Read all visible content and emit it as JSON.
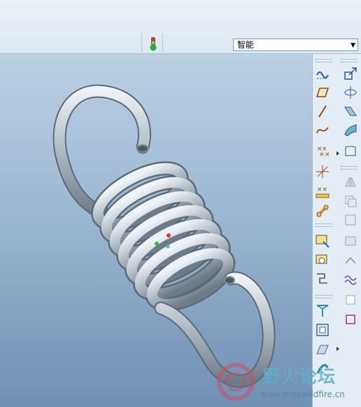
{
  "toolbar": {
    "filter_value": "智能",
    "filter_arrow": "▼"
  },
  "icons": {
    "toolbar": [
      "traffic-light-icon"
    ],
    "datum_column": [
      "datum-display-icon",
      "datum-plane-icon",
      "datum-axis-icon",
      "datum-curve-icon",
      "datum-point-icon",
      "coordinate-system-icon",
      "analysis-icon",
      "reference-icon"
    ],
    "feature_column": [
      "copy-icon",
      "revolve-icon",
      "sweep-icon",
      "blend-icon",
      "boundary-icon",
      "mirror-icon",
      "merge-icon",
      "trim-icon",
      "offset-icon",
      "thicken-icon",
      "solidify-icon",
      "extend-icon",
      "project-icon",
      "wrap-icon"
    ],
    "sketch_column": [
      "sketch-icon",
      "style-icon",
      "flatten-icon",
      "hole-icon",
      "shell-icon",
      "draft-icon",
      "more-icon"
    ]
  },
  "watermark": {
    "title": "野火论坛",
    "url": "www.proewildfire.cn"
  },
  "colors": {
    "viewport_top": "#bcd0e3",
    "viewport_bottom": "#6f8fb5",
    "spring": "#a8b3bd"
  }
}
